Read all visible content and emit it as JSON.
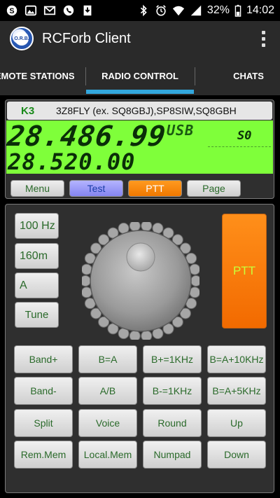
{
  "status_bar": {
    "battery_percent": "32%",
    "time": "14:02"
  },
  "app": {
    "title": "RCForb Client",
    "logo_text": "O.R.B."
  },
  "tabs": [
    {
      "label": "REMOTE STATIONS",
      "selected": false
    },
    {
      "label": "RADIO CONTROL",
      "selected": true
    },
    {
      "label": "CHATS",
      "selected": false
    }
  ],
  "radio": {
    "model": "K3",
    "operators": "3Z8FLY (ex. SQ8GBJ),SP8SIW,SQ8GBH",
    "freq_main": "28.486.99",
    "freq_sub": "28.520.00",
    "mode": "USB",
    "s_meter": "S0",
    "buttons": {
      "menu": "Menu",
      "test": "Test",
      "ptt": "PTT",
      "page": "Page"
    }
  },
  "controls": {
    "side": [
      "100 Hz",
      "160m",
      "A",
      "Tune"
    ],
    "ptt": "PTT",
    "grid": [
      [
        "Band+",
        "B=A",
        "B+=1KHz",
        "B=A+10KHz"
      ],
      [
        "Band-",
        "A/B",
        "B-=1KHz",
        "B=A+5KHz"
      ],
      [
        "Split",
        "Voice",
        "Round",
        "Up"
      ],
      [
        "Rem.Mem",
        "Local.Mem",
        "Numpad",
        "Down"
      ]
    ]
  },
  "colors": {
    "lcd_bg": "#7fff3a",
    "tab_indicator": "#33a7dd",
    "ptt_orange": "#f26a00",
    "test_blue": "#8484f0",
    "button_text_green": "#2a6a2a"
  }
}
